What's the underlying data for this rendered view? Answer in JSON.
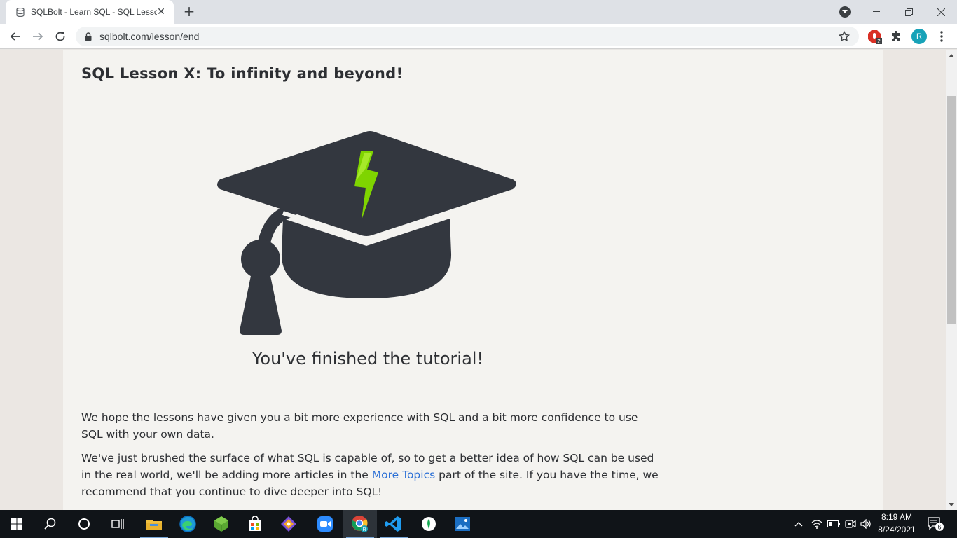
{
  "browser": {
    "tab_title": "SQLBolt - Learn SQL - SQL Lesson X: To infinity and beyond!",
    "tab_close": "✕",
    "new_tab": "+",
    "url": "sqlbolt.com/lesson/end",
    "extension_badge": "2",
    "profile_initial": "R"
  },
  "page": {
    "lesson_title": "SQL Lesson X: To infinity and beyond!",
    "finished_text": "You've finished the tutorial!",
    "paragraph1": "We hope the lessons have given you a bit more experience with SQL and a bit more confidence to use SQL with your own data.",
    "paragraph2_before_link": "We've just brushed the surface of what SQL is capable of, so to get a better idea of how SQL can be used in the real world, we'll be adding more articles in the ",
    "paragraph2_link": "More Topics",
    "paragraph2_after_link": " part of the site. If you have the time, we recommend that you continue to dive deeper into SQL!"
  },
  "taskbar": {
    "time": "8:19 AM",
    "date": "8/24/2021",
    "notification_count": "6",
    "chrome_badge": "R"
  },
  "colors": {
    "cap_dark": "#33373f",
    "bolt_green": "#7fd400",
    "link": "#2a6fd6"
  }
}
